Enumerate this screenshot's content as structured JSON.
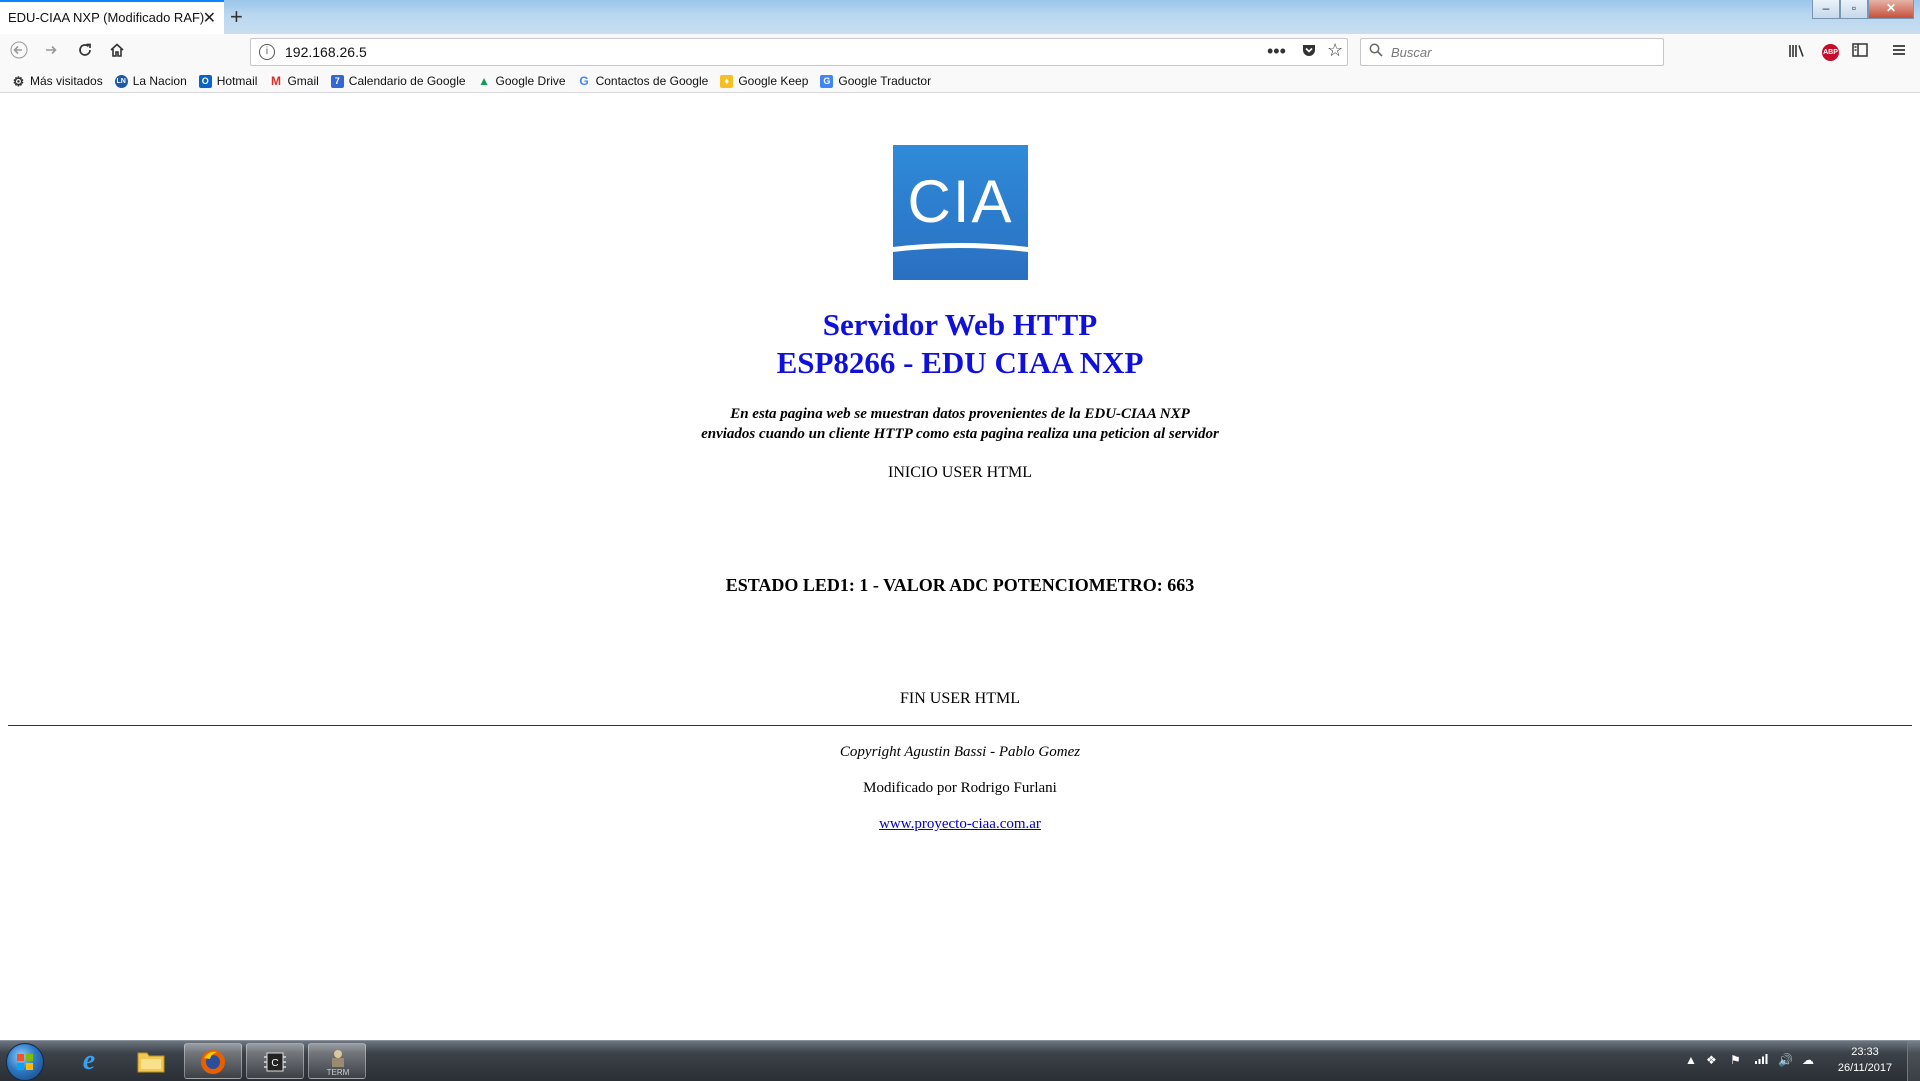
{
  "browser": {
    "tab_title": "EDU-CIAA NXP (Modificado RAF)",
    "tab_close": "✕",
    "new_tab": "+",
    "url": "192.168.26.5",
    "search_placeholder": "Buscar",
    "abp_label": "ABP",
    "window_controls": {
      "minimize": "–",
      "maximize": "▫",
      "close": "✕"
    }
  },
  "bookmarks": [
    {
      "label": "Más visitados",
      "icon": "gear-icon",
      "color": "#444444",
      "glyph": "⚙"
    },
    {
      "label": "La Nacion",
      "icon": "ln-icon",
      "color": "#1c5aa6",
      "glyph": "LN"
    },
    {
      "label": "Hotmail",
      "icon": "outlook-icon",
      "color": "#0a64c8",
      "glyph": "O"
    },
    {
      "label": "Gmail",
      "icon": "gmail-icon",
      "color": "#d93025",
      "glyph": "M"
    },
    {
      "label": "Calendario de Google",
      "icon": "calendar-icon",
      "color": "#3367d6",
      "glyph": "7"
    },
    {
      "label": "Google Drive",
      "icon": "drive-icon",
      "color": "#f4b400",
      "glyph": "▲"
    },
    {
      "label": "Contactos de Google",
      "icon": "google-icon",
      "color": "#4285f4",
      "glyph": "G"
    },
    {
      "label": "Google Keep",
      "icon": "keep-icon",
      "color": "#f6bf26",
      "glyph": "♦"
    },
    {
      "label": "Google Traductor",
      "icon": "translate-icon",
      "color": "#4285f4",
      "glyph": "G"
    }
  ],
  "page": {
    "logo_text": "CIA",
    "title_line1": "Servidor Web HTTP",
    "title_line2": "ESP8266 - EDU CIAA NXP",
    "desc_line1": "En esta pagina web se muestran datos provenientes de la EDU-CIAA NXP",
    "desc_line2": "enviados cuando un cliente HTTP como esta pagina realiza una peticion al servidor",
    "inicio": "INICIO USER HTML",
    "status": "ESTADO LED1: 1 - VALOR ADC POTENCIOMETRO: 663",
    "fin": "FIN USER HTML",
    "copyright": "Copyright Agustin Bassi - Pablo Gomez",
    "modificado": "Modificado por Rodrigo Furlani",
    "link": "www.proyecto-ciaa.com.ar"
  },
  "taskbar": {
    "time": "23:33",
    "date": "26/11/2017",
    "term_label": "TERM"
  },
  "colors": {
    "title_blue": "#1010dd",
    "logo_blue": "#2a6fc2",
    "link_blue": "#0000cc",
    "tab_accent": "#0a84ff"
  }
}
